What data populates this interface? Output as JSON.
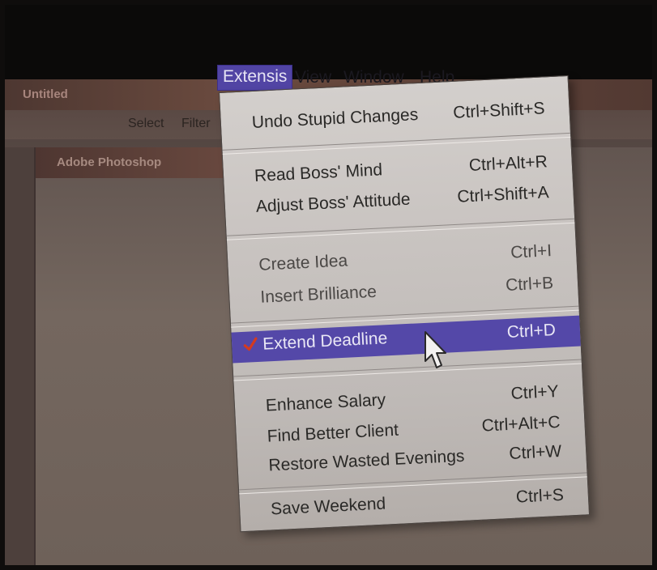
{
  "window": {
    "title": "Untitled"
  },
  "document": {
    "title": "Adobe Photoshop"
  },
  "menubar": {
    "items": [
      "Select",
      "Filter"
    ]
  },
  "top_menus": {
    "active": "Extensis",
    "items": [
      "View",
      "Window",
      "Help"
    ]
  },
  "dropdown": {
    "items": [
      {
        "label": "Undo Stupid Changes",
        "shortcut": "Ctrl+Shift+S"
      },
      {
        "label": "Read Boss' Mind",
        "shortcut": "Ctrl+Alt+R"
      },
      {
        "label": "Adjust Boss' Attitude",
        "shortcut": "Ctrl+Shift+A"
      },
      {
        "label": "Create Idea",
        "shortcut": "Ctrl+I"
      },
      {
        "label": "Insert Brilliance",
        "shortcut": "Ctrl+B"
      },
      {
        "label": "Extend Deadline",
        "shortcut": "Ctrl+D"
      },
      {
        "label": "Enhance Salary",
        "shortcut": "Ctrl+Y"
      },
      {
        "label": "Find Better Client",
        "shortcut": "Ctrl+Alt+C"
      },
      {
        "label": "Restore Wasted Evenings",
        "shortcut": "Ctrl+W"
      },
      {
        "label": "Save Weekend",
        "shortcut": "Ctrl+S"
      }
    ]
  },
  "colors": {
    "highlight": "#5448a8",
    "menu_bg": "#cac5c2",
    "check": "#d43a1f"
  },
  "icons": {
    "check": "checkmark-icon",
    "cursor": "mouse-pointer-icon"
  }
}
